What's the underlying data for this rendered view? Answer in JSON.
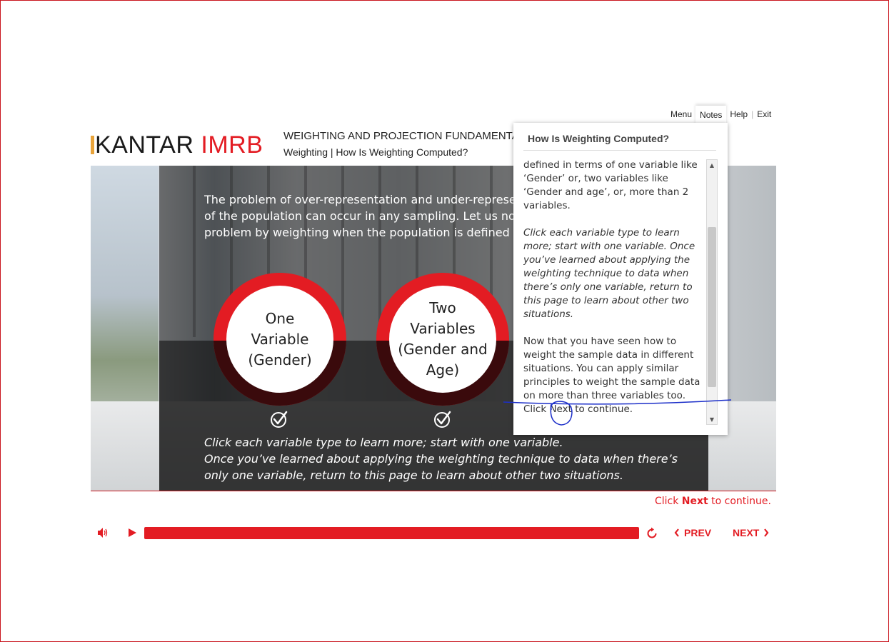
{
  "header": {
    "logo_left": "KANTAR",
    "logo_right": "IMRB",
    "course_title": "WEIGHTING AND PROJECTION FUNDAMENTALS",
    "breadcrumb": "Weighting | How Is Weighting Computed?"
  },
  "topnav": {
    "menu": "Menu",
    "notes": "Notes",
    "help": "Help",
    "exit": "Exit",
    "separator": "|"
  },
  "slide": {
    "intro_lines": [
      "The problem of over-representation and under-representation",
      "of the population can occur in any sampling. Let us now see",
      "problem by weighting when the population is defined in terms"
    ],
    "options": [
      {
        "label_lines": [
          "One",
          "Variable",
          "(Gender)"
        ],
        "completed": true
      },
      {
        "label_lines": [
          "Two",
          "Variables",
          "(Gender and",
          "Age)"
        ],
        "completed": true
      }
    ],
    "instruction_lines": [
      "Click each variable type to learn more; start with one variable.",
      "Once you’ve learned about applying the weighting technique to data when there’s",
      "only one variable, return to this page to learn about other two situations."
    ],
    "continue_prefix": "Click",
    "continue_bold": "Next",
    "continue_suffix": "to continue."
  },
  "player": {
    "prev_label": "PREV",
    "next_label": "NEXT",
    "progress": 1.0
  },
  "notes": {
    "title": "How Is Weighting Computed?",
    "para1_lines": [
      "defined in terms of one variable like",
      "‘Gender’ or, two variables like",
      "‘Gender and age’, or, more than 2",
      "variables."
    ],
    "para2_lines": [
      "Click each variable type to learn",
      "more; start with one variable. Once",
      "you’ve learned about applying the",
      "weighting technique to data when",
      "there’s only one variable, return to",
      "this page to learn about other two",
      "situations."
    ],
    "para3_lines": [
      "Now that you have seen how to",
      "weight the sample data in different",
      "situations. You can apply similar",
      "principles to weight the sample data",
      "on more than three variables too.",
      "Click Next to continue."
    ]
  },
  "colors": {
    "accent": "#e31c23",
    "frame": "#c9151e",
    "annotation": "#1c2fc9"
  }
}
